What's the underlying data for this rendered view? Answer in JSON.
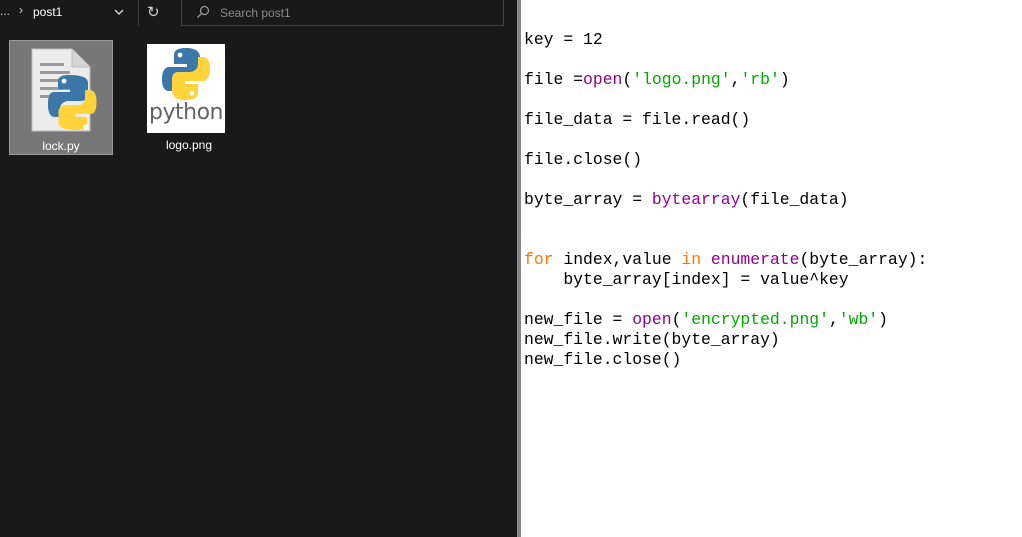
{
  "explorer": {
    "breadcrumb": {
      "overflow": "...",
      "separator": "›",
      "current": "post1"
    },
    "refresh_icon": "↻",
    "search": {
      "placeholder": "Search post1",
      "value": ""
    },
    "files": [
      {
        "name": "lock.py",
        "icon": "python-file-icon",
        "selected": true
      },
      {
        "name": "logo.png",
        "icon": "python-logo-thumbnail",
        "thumbnail_text": "python",
        "selected": false
      }
    ]
  },
  "code": {
    "colors": {
      "keyword": "#ff7700",
      "builtin": "#900090",
      "string": "#00aa00",
      "default": "#000000"
    },
    "lines": [
      [
        {
          "t": "key = 12"
        }
      ],
      [],
      [
        {
          "t": "file ="
        },
        {
          "t": "open",
          "c": "bi"
        },
        {
          "t": "("
        },
        {
          "t": "'logo.png'",
          "c": "st"
        },
        {
          "t": ","
        },
        {
          "t": "'rb'",
          "c": "st"
        },
        {
          "t": ")"
        }
      ],
      [],
      [
        {
          "t": "file_data = file.read()"
        }
      ],
      [],
      [
        {
          "t": "file.close()"
        }
      ],
      [],
      [
        {
          "t": "byte_array = "
        },
        {
          "t": "bytearray",
          "c": "bi"
        },
        {
          "t": "(file_data)"
        }
      ],
      [],
      [],
      [
        {
          "t": "for",
          "c": "kw"
        },
        {
          "t": " index,value "
        },
        {
          "t": "in",
          "c": "kw"
        },
        {
          "t": " "
        },
        {
          "t": "enumerate",
          "c": "bi"
        },
        {
          "t": "(byte_array):"
        }
      ],
      [
        {
          "t": "    byte_array[index] = value^key"
        }
      ],
      [],
      [
        {
          "t": "new_file = "
        },
        {
          "t": "open",
          "c": "bi"
        },
        {
          "t": "("
        },
        {
          "t": "'encrypted.png'",
          "c": "st"
        },
        {
          "t": ","
        },
        {
          "t": "'wb'",
          "c": "st"
        },
        {
          "t": ")"
        }
      ],
      [
        {
          "t": "new_file.write(byte_array)"
        }
      ],
      [
        {
          "t": "new_file.close()"
        }
      ]
    ]
  }
}
